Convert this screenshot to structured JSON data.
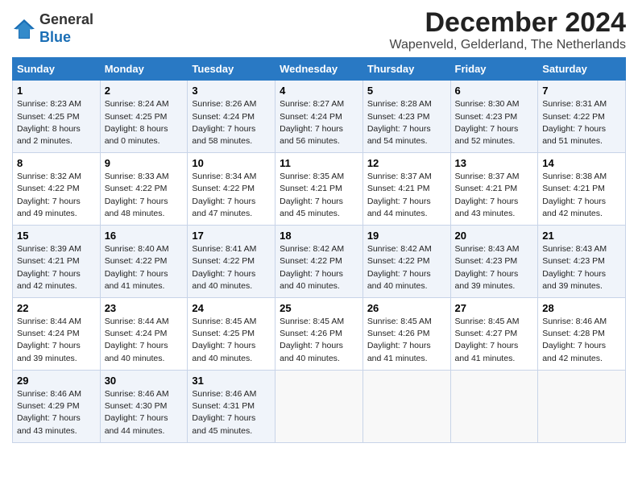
{
  "header": {
    "logo_general": "General",
    "logo_blue": "Blue",
    "title": "December 2024",
    "subtitle": "Wapenveld, Gelderland, The Netherlands"
  },
  "calendar": {
    "days_of_week": [
      "Sunday",
      "Monday",
      "Tuesday",
      "Wednesday",
      "Thursday",
      "Friday",
      "Saturday"
    ],
    "weeks": [
      [
        {
          "day": "1",
          "sunrise": "Sunrise: 8:23 AM",
          "sunset": "Sunset: 4:25 PM",
          "daylight": "Daylight: 8 hours and 2 minutes."
        },
        {
          "day": "2",
          "sunrise": "Sunrise: 8:24 AM",
          "sunset": "Sunset: 4:25 PM",
          "daylight": "Daylight: 8 hours and 0 minutes."
        },
        {
          "day": "3",
          "sunrise": "Sunrise: 8:26 AM",
          "sunset": "Sunset: 4:24 PM",
          "daylight": "Daylight: 7 hours and 58 minutes."
        },
        {
          "day": "4",
          "sunrise": "Sunrise: 8:27 AM",
          "sunset": "Sunset: 4:24 PM",
          "daylight": "Daylight: 7 hours and 56 minutes."
        },
        {
          "day": "5",
          "sunrise": "Sunrise: 8:28 AM",
          "sunset": "Sunset: 4:23 PM",
          "daylight": "Daylight: 7 hours and 54 minutes."
        },
        {
          "day": "6",
          "sunrise": "Sunrise: 8:30 AM",
          "sunset": "Sunset: 4:23 PM",
          "daylight": "Daylight: 7 hours and 52 minutes."
        },
        {
          "day": "7",
          "sunrise": "Sunrise: 8:31 AM",
          "sunset": "Sunset: 4:22 PM",
          "daylight": "Daylight: 7 hours and 51 minutes."
        }
      ],
      [
        {
          "day": "8",
          "sunrise": "Sunrise: 8:32 AM",
          "sunset": "Sunset: 4:22 PM",
          "daylight": "Daylight: 7 hours and 49 minutes."
        },
        {
          "day": "9",
          "sunrise": "Sunrise: 8:33 AM",
          "sunset": "Sunset: 4:22 PM",
          "daylight": "Daylight: 7 hours and 48 minutes."
        },
        {
          "day": "10",
          "sunrise": "Sunrise: 8:34 AM",
          "sunset": "Sunset: 4:22 PM",
          "daylight": "Daylight: 7 hours and 47 minutes."
        },
        {
          "day": "11",
          "sunrise": "Sunrise: 8:35 AM",
          "sunset": "Sunset: 4:21 PM",
          "daylight": "Daylight: 7 hours and 45 minutes."
        },
        {
          "day": "12",
          "sunrise": "Sunrise: 8:37 AM",
          "sunset": "Sunset: 4:21 PM",
          "daylight": "Daylight: 7 hours and 44 minutes."
        },
        {
          "day": "13",
          "sunrise": "Sunrise: 8:37 AM",
          "sunset": "Sunset: 4:21 PM",
          "daylight": "Daylight: 7 hours and 43 minutes."
        },
        {
          "day": "14",
          "sunrise": "Sunrise: 8:38 AM",
          "sunset": "Sunset: 4:21 PM",
          "daylight": "Daylight: 7 hours and 42 minutes."
        }
      ],
      [
        {
          "day": "15",
          "sunrise": "Sunrise: 8:39 AM",
          "sunset": "Sunset: 4:21 PM",
          "daylight": "Daylight: 7 hours and 42 minutes."
        },
        {
          "day": "16",
          "sunrise": "Sunrise: 8:40 AM",
          "sunset": "Sunset: 4:22 PM",
          "daylight": "Daylight: 7 hours and 41 minutes."
        },
        {
          "day": "17",
          "sunrise": "Sunrise: 8:41 AM",
          "sunset": "Sunset: 4:22 PM",
          "daylight": "Daylight: 7 hours and 40 minutes."
        },
        {
          "day": "18",
          "sunrise": "Sunrise: 8:42 AM",
          "sunset": "Sunset: 4:22 PM",
          "daylight": "Daylight: 7 hours and 40 minutes."
        },
        {
          "day": "19",
          "sunrise": "Sunrise: 8:42 AM",
          "sunset": "Sunset: 4:22 PM",
          "daylight": "Daylight: 7 hours and 40 minutes."
        },
        {
          "day": "20",
          "sunrise": "Sunrise: 8:43 AM",
          "sunset": "Sunset: 4:23 PM",
          "daylight": "Daylight: 7 hours and 39 minutes."
        },
        {
          "day": "21",
          "sunrise": "Sunrise: 8:43 AM",
          "sunset": "Sunset: 4:23 PM",
          "daylight": "Daylight: 7 hours and 39 minutes."
        }
      ],
      [
        {
          "day": "22",
          "sunrise": "Sunrise: 8:44 AM",
          "sunset": "Sunset: 4:24 PM",
          "daylight": "Daylight: 7 hours and 39 minutes."
        },
        {
          "day": "23",
          "sunrise": "Sunrise: 8:44 AM",
          "sunset": "Sunset: 4:24 PM",
          "daylight": "Daylight: 7 hours and 40 minutes."
        },
        {
          "day": "24",
          "sunrise": "Sunrise: 8:45 AM",
          "sunset": "Sunset: 4:25 PM",
          "daylight": "Daylight: 7 hours and 40 minutes."
        },
        {
          "day": "25",
          "sunrise": "Sunrise: 8:45 AM",
          "sunset": "Sunset: 4:26 PM",
          "daylight": "Daylight: 7 hours and 40 minutes."
        },
        {
          "day": "26",
          "sunrise": "Sunrise: 8:45 AM",
          "sunset": "Sunset: 4:26 PM",
          "daylight": "Daylight: 7 hours and 41 minutes."
        },
        {
          "day": "27",
          "sunrise": "Sunrise: 8:45 AM",
          "sunset": "Sunset: 4:27 PM",
          "daylight": "Daylight: 7 hours and 41 minutes."
        },
        {
          "day": "28",
          "sunrise": "Sunrise: 8:46 AM",
          "sunset": "Sunset: 4:28 PM",
          "daylight": "Daylight: 7 hours and 42 minutes."
        }
      ],
      [
        {
          "day": "29",
          "sunrise": "Sunrise: 8:46 AM",
          "sunset": "Sunset: 4:29 PM",
          "daylight": "Daylight: 7 hours and 43 minutes."
        },
        {
          "day": "30",
          "sunrise": "Sunrise: 8:46 AM",
          "sunset": "Sunset: 4:30 PM",
          "daylight": "Daylight: 7 hours and 44 minutes."
        },
        {
          "day": "31",
          "sunrise": "Sunrise: 8:46 AM",
          "sunset": "Sunset: 4:31 PM",
          "daylight": "Daylight: 7 hours and 45 minutes."
        },
        null,
        null,
        null,
        null
      ]
    ]
  }
}
